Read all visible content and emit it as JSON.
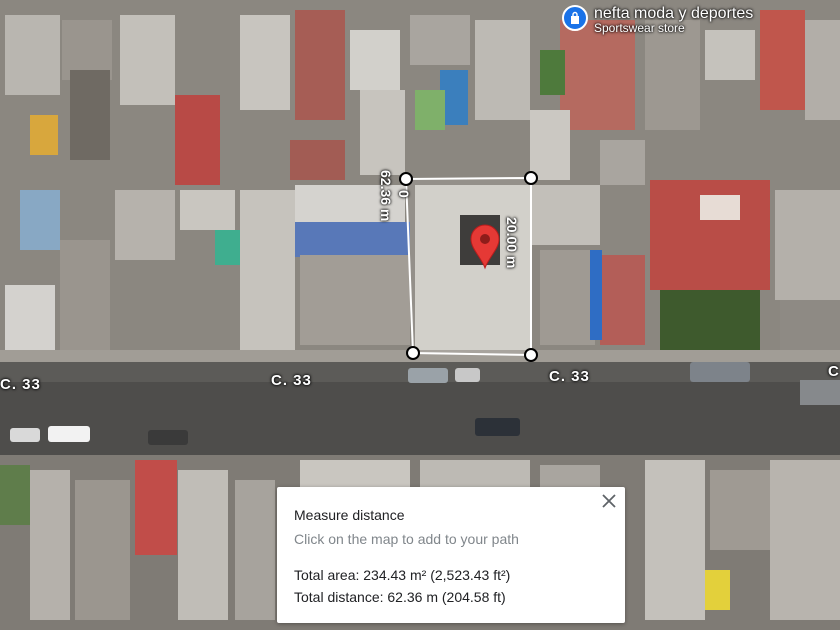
{
  "map": {
    "street_labels": [
      "C. 33",
      "C. 33",
      "C. 33",
      "C"
    ],
    "poi": {
      "name": "nefta moda y deportes",
      "category": "Sportswear store",
      "icon": "shopping-bag-icon",
      "color": "#1a73e8"
    },
    "measure_labels": {
      "top_edge": "62.36 m",
      "top_edge_suffix": "0",
      "right_edge": "20.00 m"
    },
    "marker": {
      "icon": "location-pin-icon",
      "color": "#e53935"
    }
  },
  "panel": {
    "title": "Measure distance",
    "hint": "Click on the map to add to your path",
    "area_label": "Total area:",
    "area_value": "234.43 m² (2,523.43 ft²)",
    "distance_label": "Total distance:",
    "distance_value": "62.36 m (204.58 ft)",
    "close_icon": "close-icon"
  }
}
